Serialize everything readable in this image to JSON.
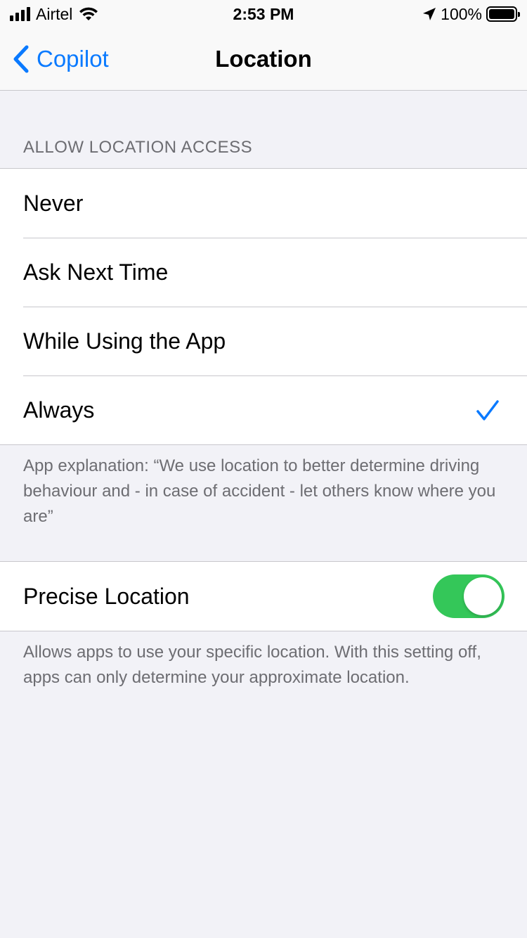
{
  "status_bar": {
    "carrier": "Airtel",
    "time": "2:53 PM",
    "battery": "100%"
  },
  "nav": {
    "back_label": "Copilot",
    "title": "Location"
  },
  "access_section": {
    "header": "ALLOW LOCATION ACCESS",
    "options": [
      {
        "label": "Never",
        "selected": false
      },
      {
        "label": "Ask Next Time",
        "selected": false
      },
      {
        "label": "While Using the App",
        "selected": false
      },
      {
        "label": "Always",
        "selected": true
      }
    ],
    "footer": "App explanation: “We use location to better determine driving behaviour and - in case of accident - let others know where you are”"
  },
  "precise_section": {
    "label": "Precise Location",
    "enabled": true,
    "footer": "Allows apps to use your specific location. With this setting off, apps can only determine your approximate location."
  },
  "colors": {
    "accent": "#0a7aff",
    "toggle_on": "#34c759",
    "background": "#f2f2f7",
    "secondary_text": "#6d6d72"
  }
}
